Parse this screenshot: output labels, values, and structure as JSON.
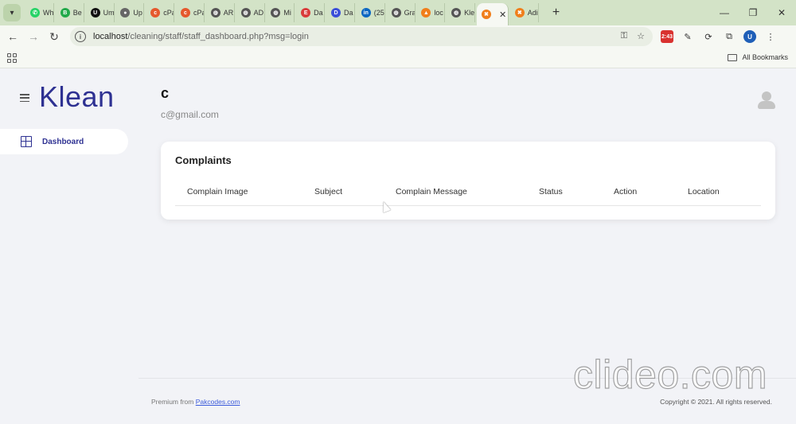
{
  "browser": {
    "tabs": [
      {
        "label": "Wh",
        "color": "#25d366",
        "glyph": "✆"
      },
      {
        "label": "Be",
        "color": "#22a94a",
        "glyph": "B"
      },
      {
        "label": "Um",
        "color": "#111111",
        "glyph": "U"
      },
      {
        "label": "Up",
        "color": "#666666",
        "glyph": "●"
      },
      {
        "label": "cPa",
        "color": "#e5582d",
        "glyph": "c"
      },
      {
        "label": "cPa",
        "color": "#e5582d",
        "glyph": "c"
      },
      {
        "label": "AR",
        "color": "#555555",
        "glyph": "◍"
      },
      {
        "label": "AD",
        "color": "#555555",
        "glyph": "◍"
      },
      {
        "label": "Mi",
        "color": "#555555",
        "glyph": "◍"
      },
      {
        "label": "Da",
        "color": "#d93b3b",
        "glyph": "E"
      },
      {
        "label": "Da",
        "color": "#3b4fd9",
        "glyph": "D"
      },
      {
        "label": "(25",
        "color": "#0a66c2",
        "glyph": "in"
      },
      {
        "label": "Gra",
        "color": "#555555",
        "glyph": "◍"
      },
      {
        "label": "loc",
        "color": "#f07e1b",
        "glyph": "▲"
      },
      {
        "label": "Kle",
        "color": "#555555",
        "glyph": "◍"
      },
      {
        "label": "",
        "color": "#f07e1b",
        "glyph": "✖",
        "active": true
      },
      {
        "label": "Adi",
        "color": "#f07e1b",
        "glyph": "✖"
      }
    ],
    "url_host": "localhost",
    "url_path": "/cleaning/staff/staff_dashboard.php?msg=login",
    "extension_badge": "2:43",
    "profile_initial": "U",
    "all_bookmarks": "All Bookmarks"
  },
  "sidebar": {
    "logo": "Klean",
    "items": [
      {
        "label": "Dashboard"
      }
    ]
  },
  "user": {
    "name": "c",
    "email": "c@gmail.com"
  },
  "complaints": {
    "title": "Complaints",
    "columns": [
      "Complain Image",
      "Subject",
      "Complain Message",
      "Status",
      "Action",
      "Location"
    ],
    "rows": []
  },
  "footer": {
    "prefix": "Premium from ",
    "link": "Pakcodes.com",
    "copyright": "Copyright © 2021. All rights reserved."
  },
  "watermark": "clideo.com"
}
